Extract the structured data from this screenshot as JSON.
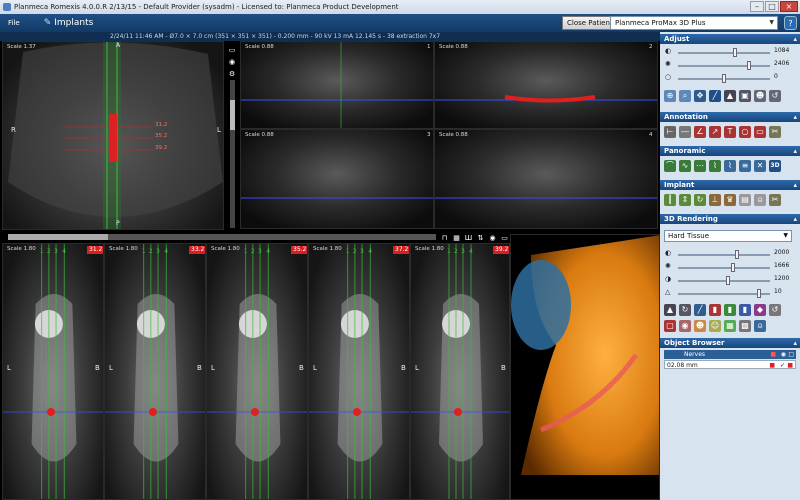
{
  "window": {
    "title": "Planmeca Romexis 4.0.0.R  2/13/15 - Default Provider (sysadm) - Licensed to: Planmeca Product Development"
  },
  "menu": {
    "file": "File"
  },
  "module": {
    "label": "Implants"
  },
  "infobar": {
    "text": "2/24/11 11:46 AM - Ø7.0 × 7.0 cm (351 × 351 × 351) - 0.200 mm - 90 kV 13 mA 12.145 s - 38 extraction 7x7"
  },
  "header": {
    "close_patient": "Close Patient",
    "device": "Planmeca ProMax 3D Plus",
    "help": "?"
  },
  "views": {
    "sagittal": {
      "scale": "Scale 1.37",
      "left": "R",
      "right": "L",
      "top": "A",
      "bottom": "P",
      "measures": [
        "31.2",
        "35.2",
        "39.2"
      ]
    },
    "axial": [
      {
        "scale": "Scale 0.88",
        "num": "1"
      },
      {
        "scale": "Scale 0.88",
        "num": "2"
      },
      {
        "scale": "Scale 0.88",
        "num": "3"
      },
      {
        "scale": "Scale 0.88",
        "num": "4"
      }
    ],
    "cross": [
      {
        "scale": "Scale 1.80",
        "mm": "31.2"
      },
      {
        "scale": "Scale 1.80",
        "mm": "33.2"
      },
      {
        "scale": "Scale 1.80",
        "mm": "35.2"
      },
      {
        "scale": "Scale 1.80",
        "mm": "37.2"
      },
      {
        "scale": "Scale 1.80",
        "mm": "39.2"
      }
    ],
    "cross_markers": [
      "1",
      "2",
      "3",
      "4"
    ],
    "cross_left": "L",
    "cross_right": "B"
  },
  "panel": {
    "adjust": {
      "title": "Adjust",
      "sliders": [
        {
          "value": "1084",
          "pos": 0.62
        },
        {
          "value": "2406",
          "pos": 0.78
        },
        {
          "value": "0",
          "pos": 0.5
        }
      ]
    },
    "annotation": {
      "title": "Annotation"
    },
    "panoramic": {
      "title": "Panoramic",
      "label_3d": "3D"
    },
    "implant": {
      "title": "Implant"
    },
    "rendering": {
      "title": "3D Rendering",
      "preset": "Hard Tissue",
      "sliders": [
        {
          "value": "2000",
          "pos": 0.65
        },
        {
          "value": "1666",
          "pos": 0.6
        },
        {
          "value": "1200",
          "pos": 0.55
        },
        {
          "value": "10",
          "pos": 0.9
        }
      ]
    },
    "object_browser": {
      "title": "Object Browser",
      "nerves": "Nerves",
      "nerve_item": "02.08 mm"
    }
  },
  "colors": {
    "accent": "#1e4f86",
    "measure": "#d82020",
    "guide": "#3dbb3d"
  }
}
